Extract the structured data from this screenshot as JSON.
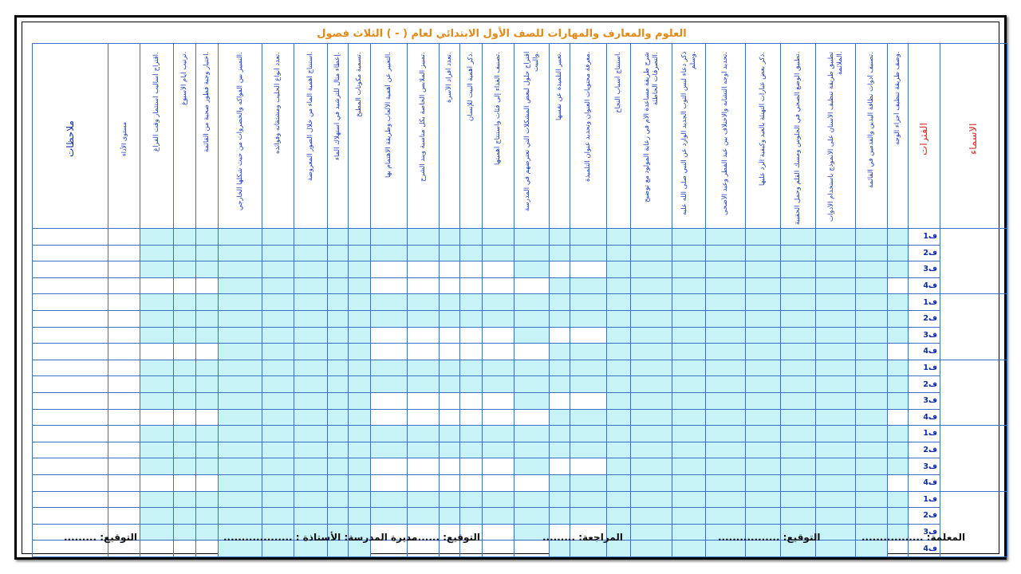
{
  "title": "العلوم والمعارف والمهارات للصف الأول الابتدائي لعام (          -          ) الثلاث فصول",
  "columns": [
    {
      "label": "ملاحظات",
      "style": "big"
    },
    {
      "label": "مستوى الأداء",
      "style": "small"
    },
    {
      "label": "اقتراح أساليب استثمار وقت الفراغ.",
      "style": "normal"
    },
    {
      "label": "ترتيب أيام الأسبوع.",
      "style": "normal"
    },
    {
      "label": "اختيار وجبة فطور صحية من القائمة.",
      "style": "normal"
    },
    {
      "label": "التمييز بين الفواكه والخضروات من حيث شكلها الخارجي.",
      "style": "normal"
    },
    {
      "label": "تعدد أنواع الحليب ومشتقاته وفوائده.",
      "style": "normal"
    },
    {
      "label": "استنتاج أهمية الماء من خلال الصور المعروضة.",
      "style": "normal"
    },
    {
      "label": "إعطاء مثال للترشيد في استهلاك الماء.",
      "style": "normal"
    },
    {
      "label": "تسمية مكونات المطبخ.",
      "style": "normal"
    },
    {
      "label": "التعبير عن أهمية الألعاب وطريقة الاهتمام بها.",
      "style": "normal"
    },
    {
      "label": "تمييز الملابس الخاصة بكل مناسبة وبند الشرح.",
      "style": "normal"
    },
    {
      "label": "تعدد أفراد الأسرة.",
      "style": "normal"
    },
    {
      "label": "ذكر أهمية البيت للإنسان.",
      "style": "normal"
    },
    {
      "label": "تصنيف الغذاء إلى فئات واستنتاج أهميتها.",
      "style": "normal"
    },
    {
      "label": "اقتراح حلول لبعض المشكلات التي تعترضهم في المدرسة والبيت.",
      "style": "normal"
    },
    {
      "label": "تعبير التلميذة عن نفسها.",
      "style": "normal"
    },
    {
      "label": "معرفة محتويات العنوان وتحديد عنوان التلميذة.",
      "style": "normal"
    },
    {
      "label": "استنتاج أسباب النجاح.",
      "style": "normal"
    },
    {
      "label": "شرح طريقة مساعدة الأم في رعاية المولود مع توضيح التصرفات الخاطئة.",
      "style": "normal"
    },
    {
      "label": "ذكر دعاء لبس الثوب الجديد الوارد عن النبي صلى الله عليه وسلم.",
      "style": "normal"
    },
    {
      "label": "تحديد أوجه التشابه والاختلاف بين عيد الفطر وعيد الأضحى.",
      "style": "normal"
    },
    {
      "label": "ذكر بعض عبارات التهنئة بالعيد وكيفية الرد عليها.",
      "style": "normal"
    },
    {
      "label": "تطبيق الوضع الصحي في الجلوس ومسك القلم وحمل الحقيبة.",
      "style": "normal"
    },
    {
      "label": "تطبيق طريقة تنظيف الأسنان على الأنموذج باستخدام الأدوات الملائمة.",
      "style": "normal"
    },
    {
      "label": "تصنيف أدوات نظافة اليدين والقدمين في القائمة.",
      "style": "normal"
    },
    {
      "label": "وصف طريقة تنظيف أجزاء الوجه.",
      "style": "normal"
    },
    {
      "label": "الفترات",
      "style": "red"
    },
    {
      "label": "الأسماء",
      "style": "names"
    }
  ],
  "period_labels": [
    "ف1",
    "ف2",
    "ف3",
    "ف4"
  ],
  "student_count": 5,
  "footer": {
    "teacher": "المعلمة: .................",
    "teacher_sign": "التوقيع: .................",
    "reviewer": "المراجعة: .........",
    "reviewer_sign": "التوقيع: .........",
    "principal": "مديرة المدرسة: الأستاذة : ...................",
    "principal_sign": "التوقيع: ........."
  },
  "colors": {
    "grid": "#3b6fc4",
    "shade": "#c8f3f6",
    "title": "#e08a1a",
    "header_text": "#1a3cc8",
    "accent_red": "#e0302b"
  }
}
